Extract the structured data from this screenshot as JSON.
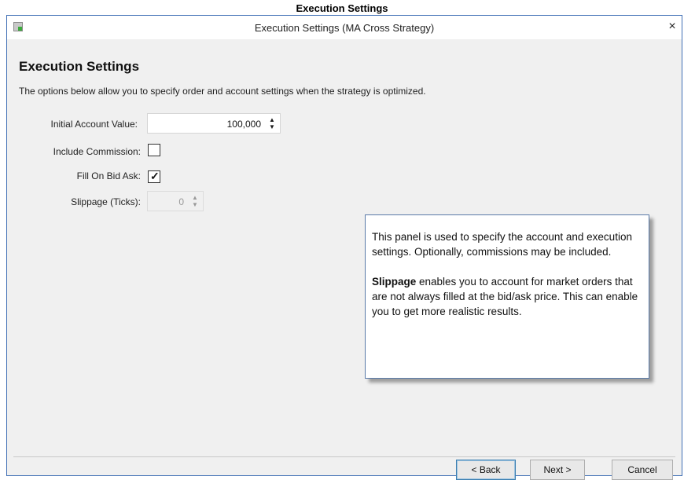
{
  "caption": "Execution Settings",
  "window": {
    "title": "Execution Settings (MA Cross Strategy)",
    "close_glyph": "×",
    "app_icon": "app-grid-icon"
  },
  "heading": "Execution Settings",
  "subtitle": "The options below allow you to specify order and account settings when the strategy is optimized.",
  "fields": {
    "initial_account": {
      "label": "Initial Account Value:",
      "value": "100,000"
    },
    "include_commission": {
      "label": "Include Commission:",
      "checked": false
    },
    "fill_on_bid_ask": {
      "label": "Fill On Bid Ask:",
      "checked": true,
      "mark": "✓"
    },
    "slippage": {
      "label": "Slippage (Ticks):",
      "value": "0",
      "enabled": false
    }
  },
  "spinner_arrows": {
    "up": "▲",
    "down": "▼"
  },
  "help": {
    "para1": "This panel is used to specify the account and execution settings.  Optionally, commissions may be included.",
    "para2_bold": "Slippage",
    "para2_rest": " enables you to account for market orders that are not always filled at the bid/ask price.  This can enable you to get more realistic results."
  },
  "buttons": {
    "back": "< Back",
    "next": "Next >",
    "cancel": "Cancel"
  },
  "colors": {
    "window_border": "#3f6fb5",
    "dialog_bg": "#f0f0f0",
    "focus_border": "#3c7fb1"
  }
}
